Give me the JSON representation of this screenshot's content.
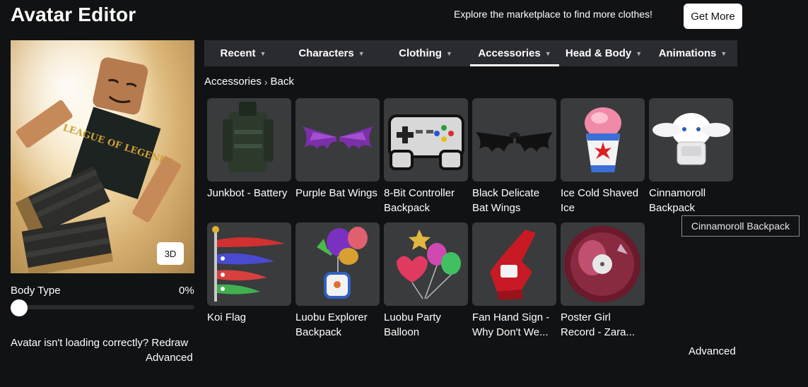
{
  "header": {
    "title": "Avatar Editor",
    "promo_text": "Explore the marketplace to find more clothes!",
    "get_more_label": "Get More"
  },
  "avatar": {
    "view_toggle_label": "3D",
    "shirt_text": "LEAGUE OF LEGENDS"
  },
  "body_type": {
    "label": "Body Type",
    "value": "0%",
    "fraction": 0
  },
  "status": {
    "message": "Avatar isn't loading correctly?",
    "redraw_label": "Redraw",
    "advanced_label": "Advanced"
  },
  "tabs": [
    {
      "label": "Recent",
      "active": false
    },
    {
      "label": "Characters",
      "active": false
    },
    {
      "label": "Clothing",
      "active": false
    },
    {
      "label": "Accessories",
      "active": true
    },
    {
      "label": "Head & Body",
      "active": false
    },
    {
      "label": "Animations",
      "active": false
    }
  ],
  "breadcrumb": {
    "current": "Accessories",
    "back_label": "Back"
  },
  "items": [
    {
      "name": "Junkbot - Battery",
      "icon": "battery-icon"
    },
    {
      "name": "Purple Bat Wings",
      "icon": "bat-wings-icon"
    },
    {
      "name": "8-Bit Controller Backpack",
      "icon": "controller-icon"
    },
    {
      "name": "Black Delicate Bat Wings",
      "icon": "black-wings-icon"
    },
    {
      "name": "Ice Cold Shaved Ice",
      "icon": "shaved-ice-icon"
    },
    {
      "name": "Cinnamoroll Backpack",
      "icon": "cinnamoroll-icon"
    },
    {
      "name": "Koi Flag",
      "icon": "koi-flag-icon"
    },
    {
      "name": "Luobu Explorer Backpack",
      "icon": "balloon-backpack-icon"
    },
    {
      "name": "Luobu Party Balloon",
      "icon": "party-balloon-icon"
    },
    {
      "name": "Fan Hand Sign - Why Don't We...",
      "icon": "foam-hand-icon"
    },
    {
      "name": "Poster Girl Record - Zara...",
      "icon": "vinyl-record-icon"
    }
  ],
  "tooltip": "Cinnamoroll Backpack",
  "footer": {
    "advanced_label": "Advanced"
  }
}
